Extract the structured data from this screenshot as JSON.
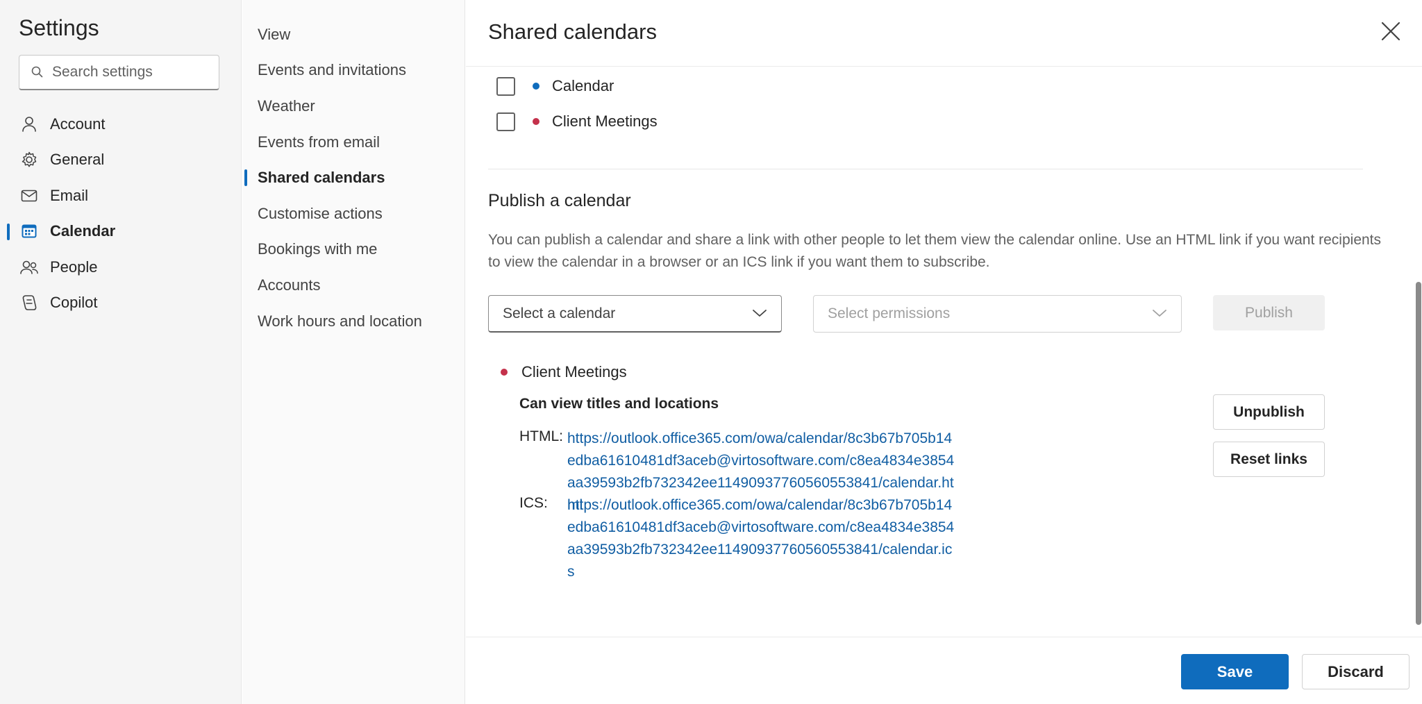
{
  "sidebar": {
    "title": "Settings",
    "search_placeholder": "Search settings",
    "items": [
      {
        "label": "Account",
        "icon": "person-icon"
      },
      {
        "label": "General",
        "icon": "gear-icon"
      },
      {
        "label": "Email",
        "icon": "mail-icon"
      },
      {
        "label": "Calendar",
        "icon": "calendar-icon",
        "active": true
      },
      {
        "label": "People",
        "icon": "people-icon"
      },
      {
        "label": "Copilot",
        "icon": "copilot-icon"
      }
    ]
  },
  "subnav": {
    "items": [
      {
        "label": "View"
      },
      {
        "label": "Events and invitations"
      },
      {
        "label": "Weather"
      },
      {
        "label": "Events from email"
      },
      {
        "label": "Shared calendars",
        "active": true
      },
      {
        "label": "Customise actions"
      },
      {
        "label": "Bookings with me"
      },
      {
        "label": "Accounts"
      },
      {
        "label": "Work hours and location"
      }
    ]
  },
  "main": {
    "title": "Shared calendars",
    "calendars": [
      {
        "label": "Calendar",
        "color": "#0f6cbd"
      },
      {
        "label": "Client Meetings",
        "color": "#c4314b"
      }
    ],
    "publish": {
      "title": "Publish a calendar",
      "description": "You can publish a calendar and share a link with other people to let them view the calendar online. Use an HTML link if you want recipients to view the calendar in a browser or an ICS link if you want them to subscribe.",
      "select_calendar_placeholder": "Select a calendar",
      "select_permissions_placeholder": "Select permissions",
      "publish_label": "Publish"
    },
    "published": {
      "calendar_name": "Client Meetings",
      "calendar_color": "#c4314b",
      "permission": "Can view titles and locations",
      "html_label": "HTML:",
      "html_url": "https://outlook.office365.com/owa/calendar/8c3b67b705b14edba61610481df3aceb@virtosoftware.com/c8ea4834e3854aa39593b2fb732342ee11490937760560553841/calendar.html",
      "ics_label": "ICS:",
      "ics_url": "https://outlook.office365.com/owa/calendar/8c3b67b705b14edba61610481df3aceb@virtosoftware.com/c8ea4834e3854aa39593b2fb732342ee11490937760560553841/calendar.ics",
      "unpublish_label": "Unpublish",
      "reset_links_label": "Reset links"
    }
  },
  "footer": {
    "save_label": "Save",
    "discard_label": "Discard"
  },
  "colors": {
    "accent": "#0f6cbd",
    "link": "#115ea3"
  }
}
